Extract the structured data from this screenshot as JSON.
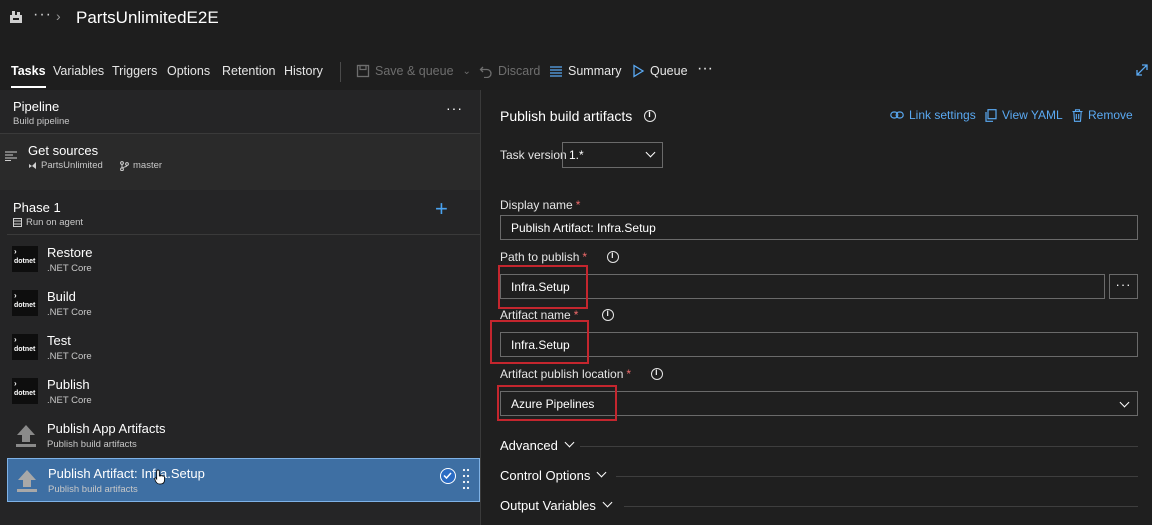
{
  "header": {
    "title": "PartsUnlimitedE2E",
    "overflow": "···",
    "logo_icon": "pipeline-icon"
  },
  "tabs": [
    {
      "label": "Tasks",
      "active": true
    },
    {
      "label": "Variables"
    },
    {
      "label": "Triggers"
    },
    {
      "label": "Options"
    },
    {
      "label": "Retention"
    },
    {
      "label": "History"
    }
  ],
  "toolbar": {
    "save_queue": "Save & queue",
    "discard": "Discard",
    "summary": "Summary",
    "queue": "Queue",
    "more": "···"
  },
  "pipeline": {
    "title": "Pipeline",
    "subtitle": "Build pipeline",
    "more": "···"
  },
  "sources": {
    "title": "Get sources",
    "repo": "PartsUnlimited",
    "branch": "master"
  },
  "phase": {
    "title": "Phase 1",
    "subtitle": "Run on agent",
    "add": "+"
  },
  "tasks": [
    {
      "name": "Restore",
      "sub": ".NET Core",
      "badge": "dotnet"
    },
    {
      "name": "Build",
      "sub": ".NET Core",
      "badge": "dotnet"
    },
    {
      "name": "Test",
      "sub": ".NET Core",
      "badge": "dotnet"
    },
    {
      "name": "Publish",
      "sub": ".NET Core",
      "badge": "dotnet"
    },
    {
      "name": "Publish App Artifacts",
      "sub": "Publish build artifacts"
    },
    {
      "name": "Publish Artifact: Infra.Setup",
      "sub": "Publish build artifacts",
      "selected": true
    }
  ],
  "detail": {
    "title": "Publish build artifacts",
    "link_settings": "Link settings",
    "view_yaml": "View YAML",
    "remove": "Remove",
    "task_version_label": "Task version",
    "task_version": "1.*",
    "display_name_label": "Display name",
    "display_name": "Publish Artifact: Infra.Setup",
    "path_label": "Path to publish",
    "path": "Infra.Setup",
    "artifact_name_label": "Artifact name",
    "artifact_name": "Infra.Setup",
    "location_label": "Artifact publish location",
    "location": "Azure Pipelines",
    "required": "*",
    "ellipsis": "···",
    "sections": [
      "Advanced",
      "Control Options",
      "Output Variables"
    ]
  },
  "colors": {
    "accent": "#5aa9f2",
    "selected": "#3e6fa3",
    "highlight": "#c4262e"
  }
}
